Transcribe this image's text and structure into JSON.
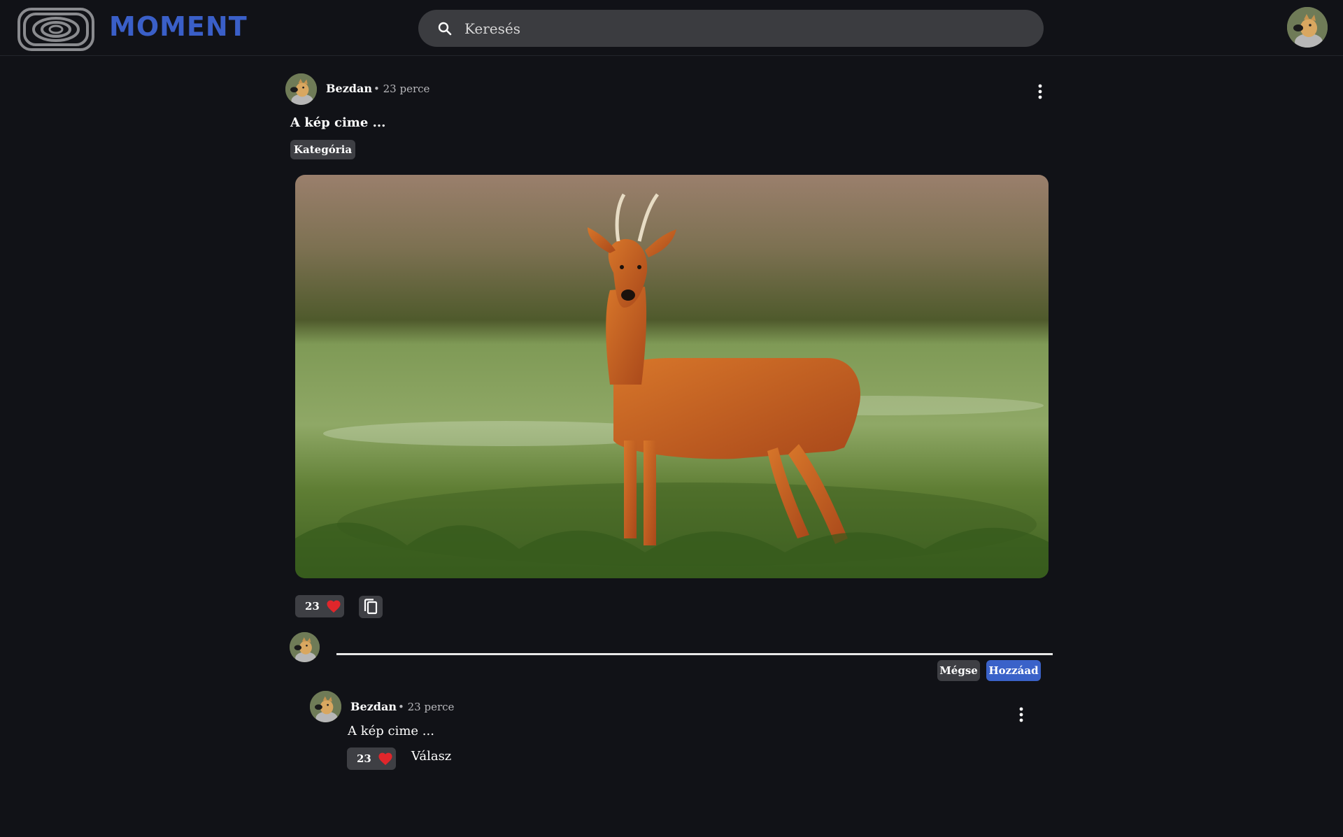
{
  "header": {
    "brand": "MOMENT",
    "search_placeholder": "Keresés"
  },
  "post": {
    "author": "Bezdan",
    "time": "• 23 perce",
    "title": "A kép cime ...",
    "category": "Kategória",
    "likes": "23"
  },
  "composer": {
    "cancel_label": "Mégse",
    "add_label": "Hozzáad"
  },
  "comment": {
    "author": "Bezdan",
    "time": "• 23 perce",
    "text": "A kép cime ...",
    "likes": "23",
    "reply_label": "Válasz"
  },
  "colors": {
    "background": "#111217",
    "brand": "#3a5fc8",
    "primary_button": "#3a62c9",
    "pill": "#3e3f44",
    "heart": "#e0262b"
  },
  "icons": [
    "logo-icon",
    "search-icon",
    "more-vert-icon",
    "heart-icon",
    "copy-icon"
  ]
}
